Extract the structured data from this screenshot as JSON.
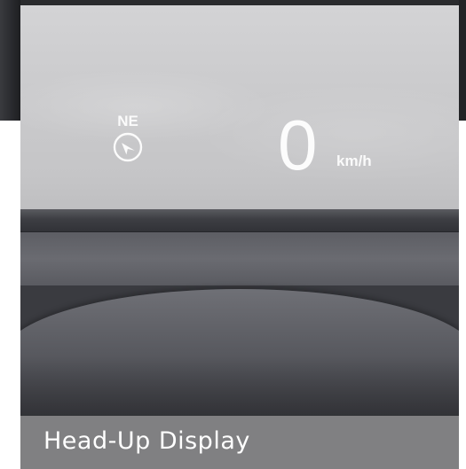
{
  "hud": {
    "compass_direction": "NE",
    "speed_value": "0",
    "speed_unit": "km/h"
  },
  "caption": {
    "title": "Head-Up Display"
  },
  "icons": {
    "compass": "compass-icon"
  },
  "colors": {
    "hud_text": "#ffffff",
    "caption_background": "#808082",
    "caption_text": "#ffffff"
  }
}
